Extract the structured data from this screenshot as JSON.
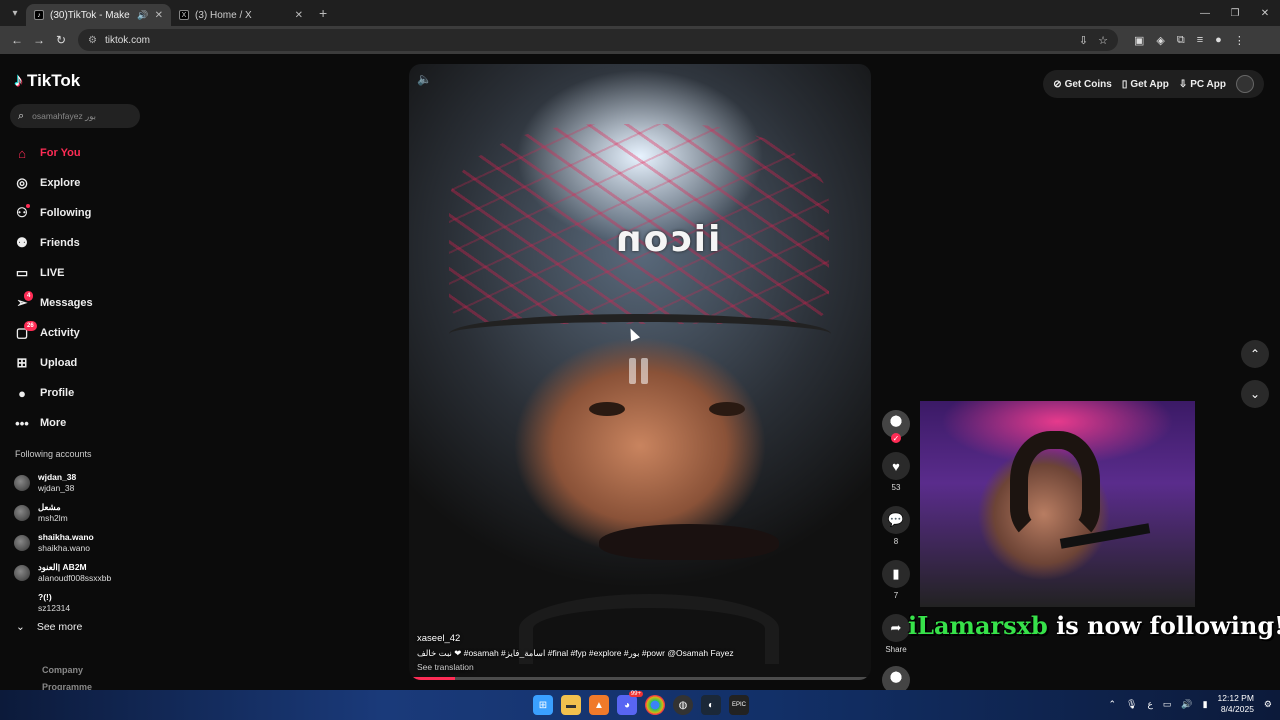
{
  "browser": {
    "tabs": [
      {
        "title": "(30)TikTok - Make Your Day",
        "active": true
      },
      {
        "title": "(3) Home / X",
        "active": false
      }
    ],
    "url": "tiktok.com"
  },
  "sidebar": {
    "logo": "TikTok",
    "search_placeholder": "osamahfayez بور",
    "nav": [
      {
        "label": "For You",
        "icon": "home-icon",
        "active": true
      },
      {
        "label": "Explore",
        "icon": "compass-icon"
      },
      {
        "label": "Following",
        "icon": "user-follow-icon"
      },
      {
        "label": "Friends",
        "icon": "friends-icon"
      },
      {
        "label": "LIVE",
        "icon": "live-icon"
      },
      {
        "label": "Messages",
        "icon": "send-icon",
        "badge": "4"
      },
      {
        "label": "Activity",
        "icon": "activity-icon",
        "badge": "26"
      },
      {
        "label": "Upload",
        "icon": "plus-square-icon"
      },
      {
        "label": "Profile",
        "icon": "profile-icon"
      },
      {
        "label": "More",
        "icon": "ellipsis-icon"
      }
    ],
    "following_header": "Following accounts",
    "following": [
      {
        "name": "wjdan_38",
        "handle": "wjdan_38"
      },
      {
        "name": "مشعل",
        "handle": "msh2lm"
      },
      {
        "name": "shaikha.wano",
        "handle": "shaikha.wano"
      },
      {
        "name": "العنود| AB2M",
        "handle": "alanoudf008ssxxbb"
      },
      {
        "name": "?(!)",
        "handle": "sz12314"
      }
    ],
    "see_more": "See more",
    "footer": [
      "Company",
      "Programme"
    ]
  },
  "video": {
    "helmet_text": "iicon",
    "username": "xaseel_42",
    "description": "نبت خالف  ❤  #osamah  #اسامة_فايز  #final  #fyp  #explore  #بور  #powr  @Osamah Fayez",
    "see_translation": "See translation",
    "progress": 0.1
  },
  "actions": {
    "likes": "53",
    "comments": "8",
    "saves": "7",
    "share_label": "Share"
  },
  "topbar": {
    "get_coins": "Get Coins",
    "get_app": "Get App",
    "pc_app": "PC App"
  },
  "overlay": {
    "follower_name": "iLamarsxb",
    "follow_text": " is now following!"
  },
  "taskbar": {
    "time": "12:12 PM",
    "date": "8/4/2025",
    "chat_badge": "99+"
  }
}
